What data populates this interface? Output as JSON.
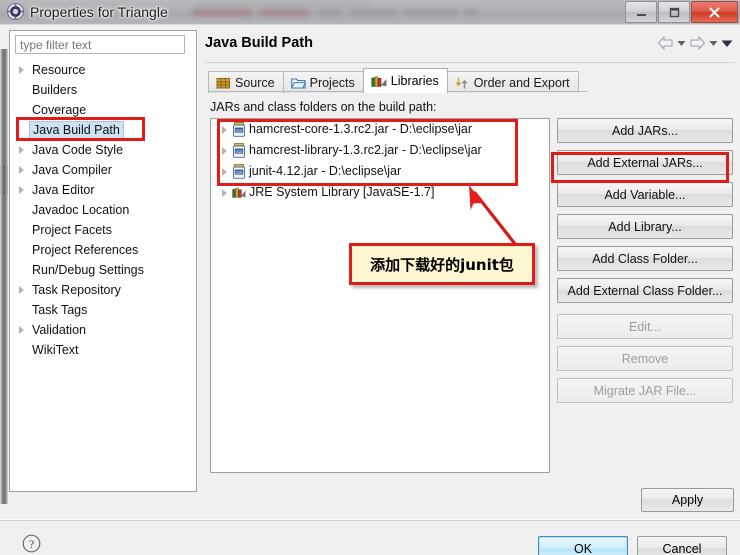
{
  "window": {
    "title": "Properties for Triangle",
    "app_icon": "eclipse-properties-icon",
    "controls": {
      "minimize": "Minimize",
      "maximize": "Restore",
      "close": "Close"
    }
  },
  "sidebar": {
    "filter": {
      "value": "",
      "placeholder": "type filter text"
    },
    "items": [
      {
        "label": "Resource",
        "expandable": true,
        "selected": false
      },
      {
        "label": "Builders",
        "expandable": false,
        "selected": false
      },
      {
        "label": "Coverage",
        "expandable": false,
        "selected": false
      },
      {
        "label": "Java Build Path",
        "expandable": false,
        "selected": true
      },
      {
        "label": "Java Code Style",
        "expandable": true,
        "selected": false
      },
      {
        "label": "Java Compiler",
        "expandable": true,
        "selected": false
      },
      {
        "label": "Java Editor",
        "expandable": true,
        "selected": false
      },
      {
        "label": "Javadoc Location",
        "expandable": false,
        "selected": false
      },
      {
        "label": "Project Facets",
        "expandable": false,
        "selected": false
      },
      {
        "label": "Project References",
        "expandable": false,
        "selected": false
      },
      {
        "label": "Run/Debug Settings",
        "expandable": false,
        "selected": false
      },
      {
        "label": "Task Repository",
        "expandable": true,
        "selected": false
      },
      {
        "label": "Task Tags",
        "expandable": false,
        "selected": false
      },
      {
        "label": "Validation",
        "expandable": true,
        "selected": false
      },
      {
        "label": "WikiText",
        "expandable": false,
        "selected": false
      }
    ]
  },
  "page": {
    "title": "Java Build Path",
    "nav": {
      "back_icon": "back-arrow-icon",
      "back_menu_icon": "chevron-down-icon",
      "forward_icon": "forward-arrow-icon",
      "forward_menu_icon": "chevron-down-icon",
      "more_icon": "chevron-down-filled-icon"
    },
    "tabs": [
      {
        "label": "Source",
        "icon": "source-package-icon",
        "active": false
      },
      {
        "label": "Projects",
        "icon": "folder-icon",
        "active": false
      },
      {
        "label": "Libraries",
        "icon": "libraries-books-icon",
        "active": true
      },
      {
        "label": "Order and Export",
        "icon": "order-export-icon",
        "active": false
      }
    ],
    "list_label": "JARs and class folders on the build path:",
    "entries": [
      {
        "label": "hamcrest-core-1.3.rc2.jar - D:\\eclipse\\jar",
        "icon": "jar-icon",
        "expandable": true
      },
      {
        "label": "hamcrest-library-1.3.rc2.jar - D:\\eclipse\\jar",
        "icon": "jar-icon",
        "expandable": true
      },
      {
        "label": "junit-4.12.jar - D:\\eclipse\\jar",
        "icon": "jar-icon",
        "expandable": true
      },
      {
        "label": "JRE System Library [JavaSE-1.7]",
        "icon": "jre-library-icon",
        "expandable": true
      }
    ],
    "buttons": [
      {
        "label": "Add JARs...",
        "enabled": true,
        "highlighted": false
      },
      {
        "label": "Add External JARs...",
        "enabled": true,
        "highlighted": true
      },
      {
        "label": "Add Variable...",
        "enabled": true,
        "highlighted": false
      },
      {
        "label": "Add Library...",
        "enabled": true,
        "highlighted": false
      },
      {
        "label": "Add Class Folder...",
        "enabled": true,
        "highlighted": false
      },
      {
        "label": "Add External Class Folder...",
        "enabled": true,
        "highlighted": false
      },
      {
        "label": "Edit...",
        "enabled": false,
        "highlighted": false
      },
      {
        "label": "Remove",
        "enabled": false,
        "highlighted": false
      },
      {
        "label": "Migrate JAR File...",
        "enabled": false,
        "highlighted": false
      }
    ],
    "apply_label": "Apply"
  },
  "footer": {
    "help_icon": "help-question-icon",
    "ok_label": "OK",
    "cancel_label": "Cancel"
  },
  "annotations": {
    "callout_text": "添加下载好的junit包",
    "highlight_color": "#e01b18",
    "callout_bg": "#fdf6d3",
    "arrow_icon": "red-arrow-icon"
  }
}
